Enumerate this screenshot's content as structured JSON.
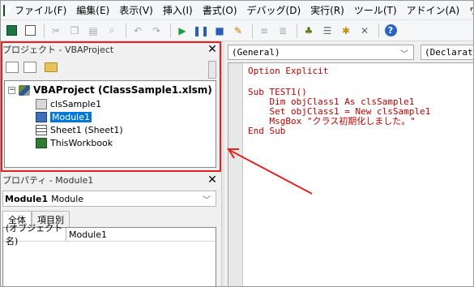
{
  "menubar": {
    "items": [
      {
        "label": "ファイル(F)"
      },
      {
        "label": "編集(E)"
      },
      {
        "label": "表示(V)"
      },
      {
        "label": "挿入(I)"
      },
      {
        "label": "書式(O)"
      },
      {
        "label": "デバッグ(D)"
      },
      {
        "label": "実行(R)"
      },
      {
        "label": "ツール(T)"
      },
      {
        "label": "アドイン(A)"
      },
      {
        "label": "ウ"
      }
    ]
  },
  "toolbar": {
    "icons": [
      "excel-view-icon",
      "insert-userform-icon",
      "cut-icon",
      "copy-icon",
      "paste-icon",
      "find-icon",
      "undo-icon",
      "redo-icon",
      "run-icon",
      "break-icon",
      "reset-icon",
      "design-mode-icon",
      "project-explorer-icon",
      "properties-window-icon",
      "object-browser-icon",
      "toolbox-icon",
      "help-icon"
    ]
  },
  "project_pane": {
    "title": "プロジェクト - VBAProject",
    "tree": {
      "root_label": "VBAProject (ClassSample1.xlsm)",
      "items": [
        {
          "label": "clsSample1",
          "icon": "class-module-icon",
          "selected": false
        },
        {
          "label": "Module1",
          "icon": "standard-module-icon",
          "selected": true
        },
        {
          "label": "Sheet1 (Sheet1)",
          "icon": "worksheet-icon",
          "selected": false
        },
        {
          "label": "ThisWorkbook",
          "icon": "workbook-icon",
          "selected": false
        }
      ]
    }
  },
  "properties_pane": {
    "title": "プロパティ - Module1",
    "object_name": "Module1",
    "object_type": "Module",
    "tabs": [
      {
        "label": "全体",
        "active": true
      },
      {
        "label": "項目別",
        "active": false
      }
    ],
    "rows": [
      {
        "key": "(オブジェクト名)",
        "value": "Module1"
      }
    ]
  },
  "code_window": {
    "procedure_combo": "(General)",
    "declarations_combo": "(Declarati",
    "lines": [
      {
        "segments": [
          {
            "text": "Option Explicit",
            "kind": "kw"
          }
        ]
      },
      {
        "segments": []
      },
      {
        "segments": [
          {
            "text": "Sub ",
            "kind": "kw"
          },
          {
            "text": "TEST1()",
            "kind": "kw"
          }
        ]
      },
      {
        "segments": [
          {
            "text": "    Dim ",
            "kind": "kw"
          },
          {
            "text": "objClass1 ",
            "kind": "kw"
          },
          {
            "text": "As ",
            "kind": "kw"
          },
          {
            "text": "clsSample1",
            "kind": "kw"
          }
        ]
      },
      {
        "segments": [
          {
            "text": "    Set ",
            "kind": "kw"
          },
          {
            "text": "objClass1 = ",
            "kind": "kw"
          },
          {
            "text": "New ",
            "kind": "kw"
          },
          {
            "text": "clsSample1",
            "kind": "kw"
          }
        ]
      },
      {
        "segments": [
          {
            "text": "    MsgBox ",
            "kind": "kw"
          },
          {
            "text": "\"クラス初期化しました。\"",
            "kind": "kw"
          }
        ]
      },
      {
        "segments": [
          {
            "text": "End Sub",
            "kind": "kw"
          }
        ]
      }
    ]
  },
  "annotation": {
    "highlight_color": "#e32222"
  }
}
